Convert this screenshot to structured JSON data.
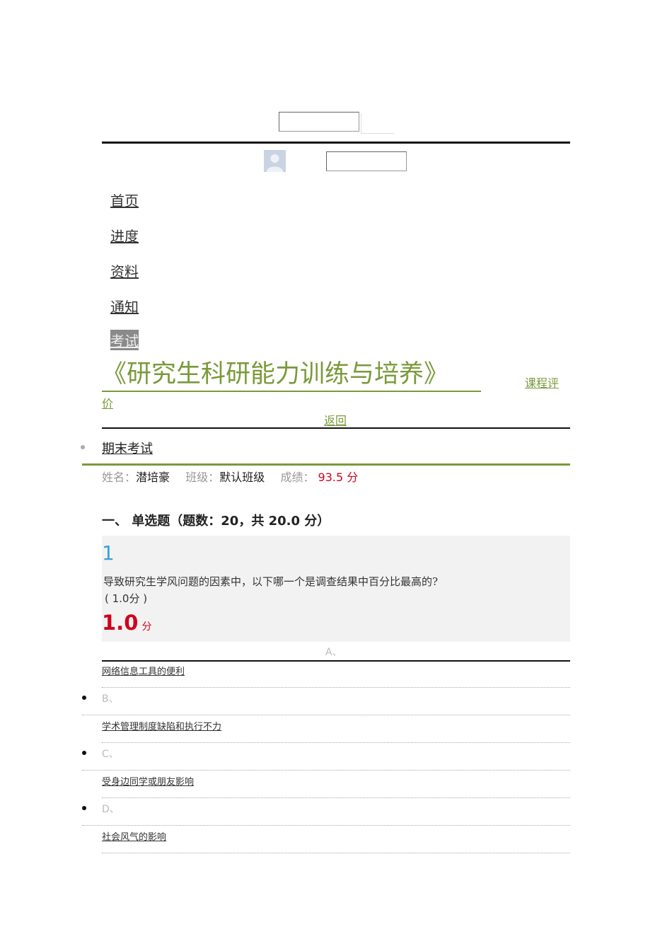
{
  "header": {
    "search_value": "",
    "user_field_value": ""
  },
  "nav": {
    "items": [
      {
        "label": "首页"
      },
      {
        "label": "进度"
      },
      {
        "label": "资料"
      },
      {
        "label": "通知"
      },
      {
        "label": "考试"
      }
    ],
    "active": "考试"
  },
  "course": {
    "title": "《研究生科研能力训练与培养》",
    "rating_link_part1": "课程评",
    "rating_link_part2": "价",
    "back_link": "返回"
  },
  "exam": {
    "section_title": "期末考试",
    "name_label": "姓名：",
    "name_value": "潜培豪",
    "class_label": "班级：",
    "class_value": "默认班级",
    "score_label": "成绩：",
    "score_value": "93.5 分"
  },
  "section": {
    "heading": "一、 单选题（题数：20，共 20.0 分）"
  },
  "question": {
    "number": "1",
    "text": "导致研究生学风问题的因素中，以下哪一个是调查结果中百分比最高的?",
    "points_note": "( 1.0分 )",
    "earned": "1.0",
    "earned_unit": "分",
    "options": [
      {
        "letter": "A、",
        "text": "网络信息工具的便利"
      },
      {
        "letter": "B、",
        "text": "学术管理制度缺陷和执行不力"
      },
      {
        "letter": "C、",
        "text": "受身边同学或朋友影响"
      },
      {
        "letter": "D、",
        "text": "社会风气的影响"
      }
    ]
  },
  "colors": {
    "accent_green": "#7a9a3a",
    "score_red": "#d0021b",
    "question_number_blue": "#3aa0d8"
  }
}
